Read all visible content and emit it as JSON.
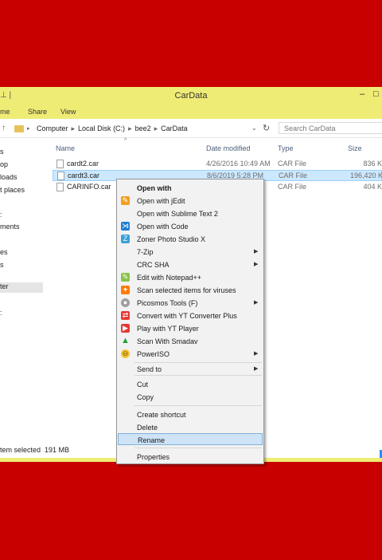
{
  "window": {
    "title": "CarData",
    "title_left": "⊥ |",
    "minimize": "–",
    "maximize": "□"
  },
  "ribbon": {
    "tabs": [
      "me",
      "Share",
      "View"
    ]
  },
  "address": {
    "crumbs": [
      "Computer",
      "Local Disk (C:)",
      "bee2",
      "CarData"
    ],
    "search_placeholder": "Search CarData"
  },
  "nav": {
    "items": [
      "s",
      "op",
      "loads",
      "t places",
      ":",
      "ments",
      "es",
      "s",
      "ter",
      ":"
    ]
  },
  "columns": {
    "name": "Name",
    "date": "Date modified",
    "type": "Type",
    "size": "Size"
  },
  "files": [
    {
      "name": "cardt2.car",
      "date": "4/26/2016 10:49 AM",
      "type": "CAR File",
      "size": "836 K"
    },
    {
      "name": "cardt3.car",
      "date": "8/6/2019 5:28 PM",
      "type": "CAR File",
      "size": "196,420 K",
      "selected": true
    },
    {
      "name": "CARINFO.car",
      "date": "",
      "type": "CAR File",
      "size": "404 K"
    }
  ],
  "status": {
    "selected": "tem selected",
    "size": "191 MB"
  },
  "context_menu": {
    "items": [
      {
        "label": "Open with",
        "bold": true
      },
      {
        "label": "Open with jEdit",
        "icon": "jedit-icon"
      },
      {
        "label": "Open with Sublime Text 2"
      },
      {
        "label": "Open with Code",
        "icon": "vscode-icon"
      },
      {
        "label": "Zoner Photo Studio X",
        "icon": "zoner-icon"
      },
      {
        "label": "7-Zip",
        "submenu": true
      },
      {
        "label": "CRC SHA",
        "submenu": true
      },
      {
        "label": "Edit with Notepad++",
        "icon": "notepad-plus-plus-icon"
      },
      {
        "label": "Scan selected items for viruses",
        "icon": "antivirus-icon"
      },
      {
        "label": "Picosmos Tools (F)",
        "icon": "picosmos-icon",
        "submenu": true
      },
      {
        "label": "Convert with YT Converter Plus",
        "icon": "yt-converter-icon"
      },
      {
        "label": "Play with YT Player",
        "icon": "yt-player-icon"
      },
      {
        "label": "Scan With Smadav",
        "icon": "smadav-icon"
      },
      {
        "label": "PowerISO",
        "icon": "poweriso-icon",
        "submenu": true
      },
      {
        "label": "Send to",
        "submenu": true
      },
      {
        "label": "Cut"
      },
      {
        "label": "Copy"
      },
      {
        "label": "Create shortcut"
      },
      {
        "label": "Delete"
      },
      {
        "label": "Rename",
        "highlighted": true
      },
      {
        "label": "Properties"
      }
    ]
  }
}
